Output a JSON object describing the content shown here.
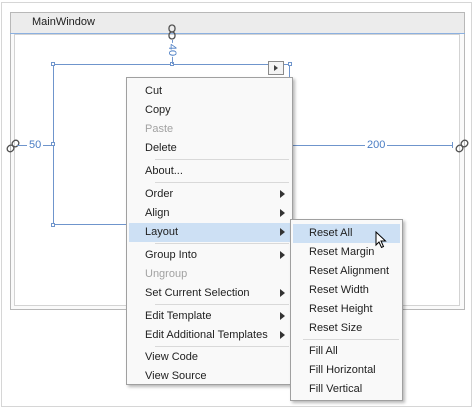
{
  "window": {
    "title": "MainWindow"
  },
  "margins": {
    "top": "40",
    "left": "50",
    "right": "200"
  },
  "context_menu": {
    "items": [
      {
        "label": "Cut",
        "disabled": false,
        "submenu": false
      },
      {
        "label": "Copy",
        "disabled": false,
        "submenu": false
      },
      {
        "label": "Paste",
        "disabled": true,
        "submenu": false
      },
      {
        "label": "Delete",
        "disabled": false,
        "submenu": false
      },
      {
        "label": "About...",
        "disabled": false,
        "submenu": false
      },
      {
        "label": "Order",
        "disabled": false,
        "submenu": true
      },
      {
        "label": "Align",
        "disabled": false,
        "submenu": true
      },
      {
        "label": "Layout",
        "disabled": false,
        "submenu": true,
        "highlighted": true
      },
      {
        "label": "Group Into",
        "disabled": false,
        "submenu": true
      },
      {
        "label": "Ungroup",
        "disabled": true,
        "submenu": false
      },
      {
        "label": "Set Current Selection",
        "disabled": false,
        "submenu": true
      },
      {
        "label": "Edit Template",
        "disabled": false,
        "submenu": true
      },
      {
        "label": "Edit Additional Templates",
        "disabled": false,
        "submenu": true
      },
      {
        "label": "View Code",
        "disabled": false,
        "submenu": false
      },
      {
        "label": "View Source",
        "disabled": false,
        "submenu": false
      }
    ]
  },
  "layout_submenu": {
    "items": [
      {
        "label": "Reset All",
        "highlighted": true
      },
      {
        "label": "Reset Margin"
      },
      {
        "label": "Reset Alignment"
      },
      {
        "label": "Reset Width"
      },
      {
        "label": "Reset Height"
      },
      {
        "label": "Reset Size"
      },
      {
        "label": "Fill All"
      },
      {
        "label": "Fill Horizontal"
      },
      {
        "label": "Fill Vertical"
      }
    ]
  },
  "colors": {
    "highlight": "#cde0f4",
    "guide": "#6f95cc",
    "margin_label": "#4a7dc4",
    "disabled_text": "#a2a2a2"
  },
  "icons": [
    "chain-link-icon",
    "submenu-arrow-icon",
    "smart-tag-arrow-icon",
    "mouse-pointer-icon"
  ]
}
